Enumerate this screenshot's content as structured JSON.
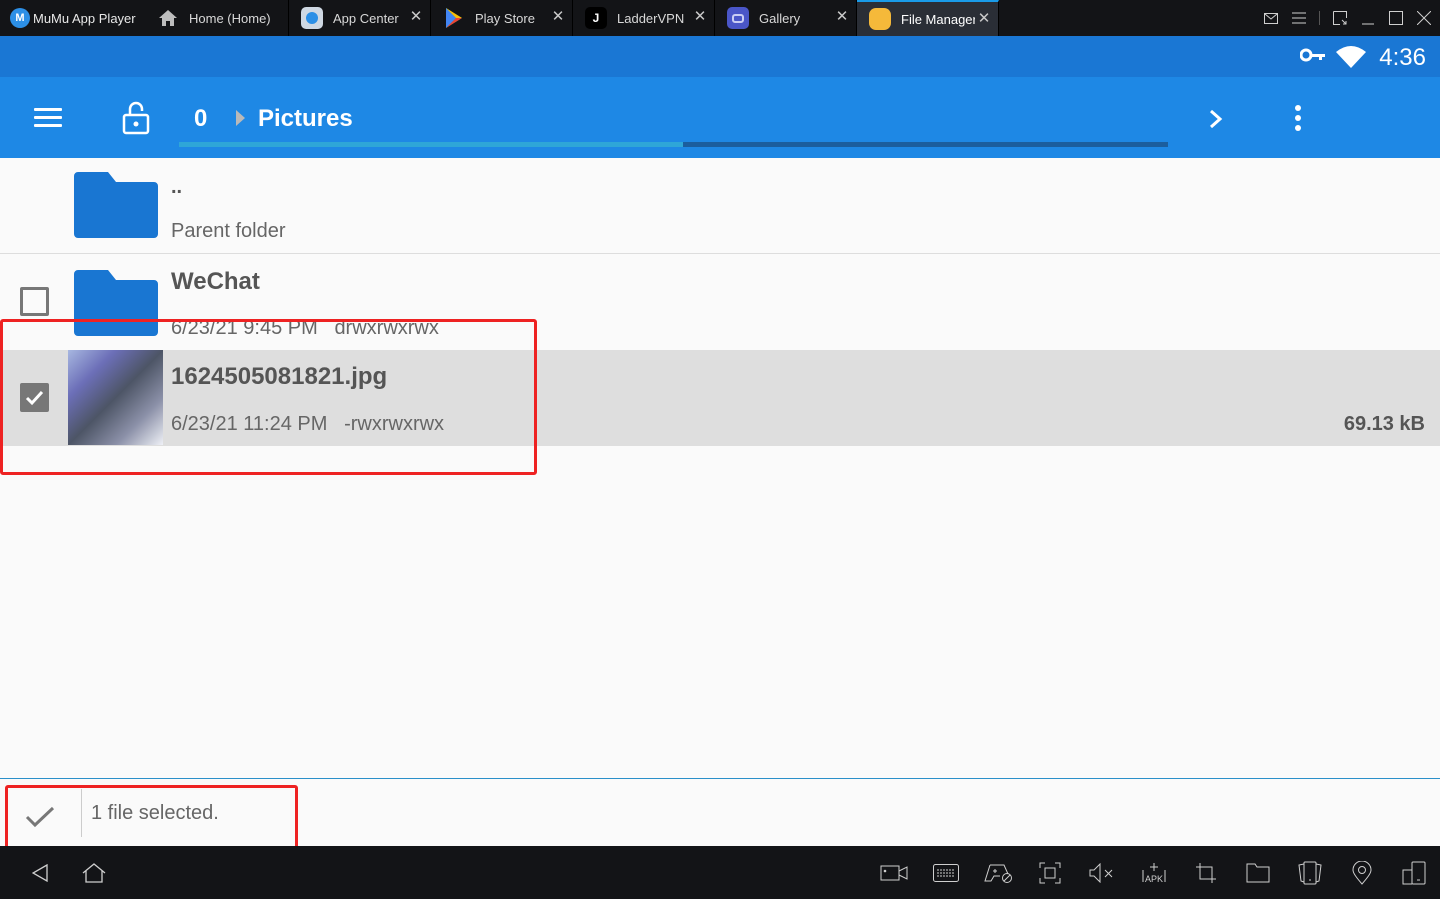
{
  "window": {
    "app_name": "MuMu App Player",
    "tabs": [
      {
        "label": "Home (Home)",
        "icon": "home-icon",
        "closable": false,
        "active": false
      },
      {
        "label": "App Center",
        "icon": "app-center-icon",
        "closable": true,
        "active": false
      },
      {
        "label": "Play Store",
        "icon": "play-store-icon",
        "closable": true,
        "active": false
      },
      {
        "label": "LadderVPN",
        "icon": "laddervpn-icon",
        "closable": true,
        "active": false
      },
      {
        "label": "Gallery",
        "icon": "gallery-icon",
        "closable": true,
        "active": false
      },
      {
        "label": "File Manager",
        "icon": "file-manager-icon",
        "closable": true,
        "active": true
      }
    ],
    "controls": [
      "mail-icon",
      "menu-icon",
      "restore-window-icon",
      "minimize-icon",
      "maximize-icon",
      "close-icon"
    ]
  },
  "statusbar": {
    "time": "4:36",
    "icons": [
      "vpn-key-icon",
      "wifi-icon"
    ]
  },
  "appbar": {
    "breadcrumb": [
      "0",
      "Pictures"
    ],
    "load_progress_percent": 51,
    "colors": {
      "appbar": "#1e88e5",
      "statusbar": "#1a77d4"
    }
  },
  "files": [
    {
      "name": "..",
      "meta": "Parent folder",
      "type": "parent-folder"
    },
    {
      "name": "WeChat",
      "meta": "6/23/21 9:45 PM   drwxrwxrwx",
      "type": "folder",
      "checked": false
    },
    {
      "name": "1624505081821.jpg",
      "meta": "6/23/21 11:24 PM   -rwxrwxrwx",
      "size": "69.13 kB",
      "type": "image",
      "checked": true
    }
  ],
  "selection_bar": {
    "message": "1 file selected."
  },
  "navbar": {
    "left": [
      "back-icon",
      "home-icon"
    ],
    "right": [
      "screen-record-icon",
      "keyboard-icon",
      "gamepad-icon",
      "screenshot-icon",
      "volume-mute-icon",
      "install-apk-icon",
      "crop-icon",
      "folder-icon",
      "shake-icon",
      "location-icon",
      "multi-instance-icon"
    ]
  }
}
